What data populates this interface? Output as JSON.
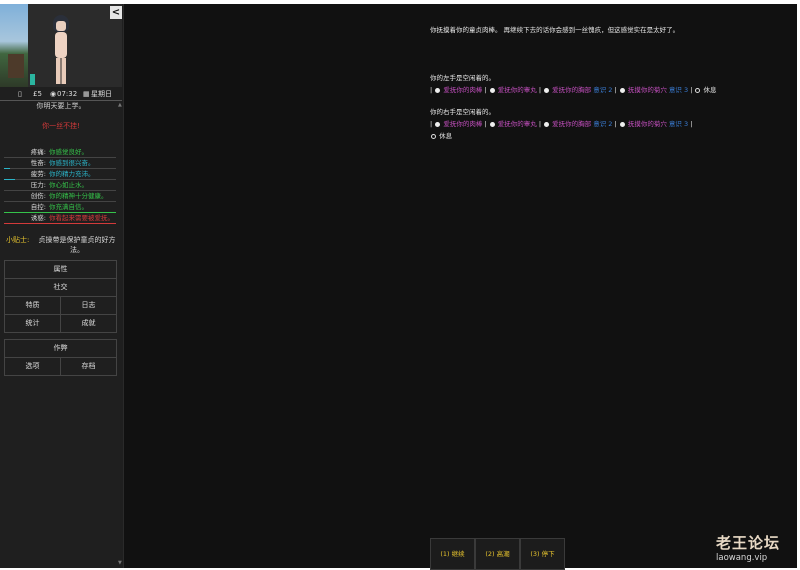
{
  "sidebar": {
    "collapse_icon": "<",
    "status": {
      "money": "£5",
      "time": "07:32",
      "day": "星期日"
    },
    "school_line": "你明天要上学。",
    "warn_line": "你一丝不挂!",
    "stats": [
      {
        "label": "疼痛:",
        "value": "你感觉良好。",
        "color": "#35c24a",
        "fill": 0.0
      },
      {
        "label": "性奋:",
        "value": "你感到很兴奋。",
        "color": "#2bb5c9",
        "fill": 0.05
      },
      {
        "label": "疲劳:",
        "value": "你的精力充沛。",
        "color": "#2bb5c9",
        "fill": 0.1
      },
      {
        "label": "压力:",
        "value": "你心如止水。",
        "color": "#35c24a",
        "fill": 0.0
      },
      {
        "label": "创伤:",
        "value": "你的精神十分健康。",
        "color": "#35c24a",
        "fill": 0.0
      },
      {
        "label": "自控:",
        "value": "你充满自信。",
        "color": "#35c24a",
        "fill": 1.0
      },
      {
        "label": "诱惑:",
        "value": "你看起来需要被爱抚。",
        "color": "#d33a3a",
        "fill": 1.0
      }
    ],
    "tip": {
      "label": "小贴士:",
      "text": "贞操带是保护童贞的好方法。"
    },
    "menu1": [
      [
        "属性"
      ],
      [
        "社交"
      ],
      [
        "特质",
        "日志"
      ],
      [
        "统计",
        "成就"
      ]
    ],
    "menu2": [
      [
        "作弊"
      ],
      [
        "选项",
        "存档"
      ]
    ]
  },
  "main": {
    "intro": "你抚摸着你的童贞肉棒。 再继续下去的话你会感到一丝愧疚，但这感觉实在是太好了。",
    "left_hand_title": "你的左手是空闲着的。",
    "left_hand_options": [
      {
        "text": "爱抚你的肉棒",
        "color": "pink"
      },
      {
        "text": "爱抚你的睾丸",
        "color": "pink"
      },
      {
        "text": "爱抚你的胸部",
        "color": "pink",
        "suffix": "意识 2"
      },
      {
        "text": "抚摸你的菊穴",
        "color": "pink",
        "suffix": "意识 3"
      }
    ],
    "left_hand_rest": "休息",
    "right_hand_title": "你的右手是空闲着的。",
    "right_hand_options": [
      {
        "text": "爱抚你的肉棒",
        "color": "pink"
      },
      {
        "text": "爱抚你的睾丸",
        "color": "pink"
      },
      {
        "text": "爱抚你的胸部",
        "color": "pink",
        "suffix": "意识 2"
      },
      {
        "text": "抚摸你的菊穴",
        "color": "pink",
        "suffix": "意识 3"
      }
    ],
    "right_hand_rest": "休息",
    "buttons": [
      "(1) 继续",
      "(2) 高潮",
      "(3) 停下"
    ]
  },
  "watermark": {
    "big": "老王论坛",
    "small": "laowang.vip"
  }
}
